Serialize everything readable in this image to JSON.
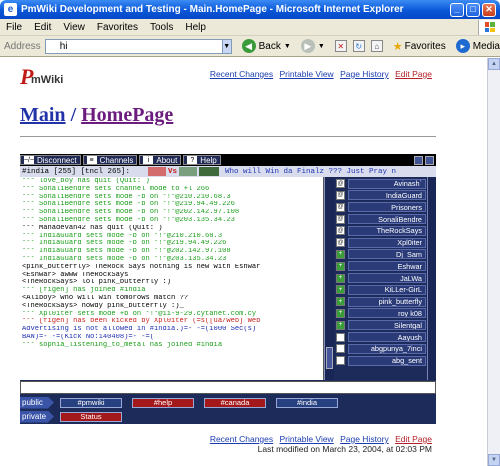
{
  "window": {
    "title": "PmWiki Development and Testing - Main.HomePage - Microsoft Internet Explorer",
    "min": "_",
    "max": "□",
    "close": "✕"
  },
  "menu": [
    "File",
    "Edit",
    "View",
    "Favorites",
    "Tools",
    "Help"
  ],
  "toolbar": {
    "address_label": "Address",
    "address_value": "hi",
    "back_label": "Back",
    "favorites_label": "Favorites",
    "media_label": "Media"
  },
  "page": {
    "logo_main": "P",
    "logo_sub": "mWiki",
    "links": [
      "Recent Changes",
      "Printable View",
      "Page History",
      "Edit Page"
    ],
    "group": "Main",
    "separator": "/",
    "pagename": "HomePage",
    "last_modified": "Last modified on March 23, 2004, at 02:03 PM"
  },
  "applet": {
    "buttons": {
      "disconnect": "Disconnect",
      "channels": "Channels",
      "about": "About",
      "help": "Help"
    },
    "topic": {
      "channel": "#india [255] [tncl 265]:",
      "vs": "Vs",
      "text": "Who will Win da Finalz ??? Just Pray n"
    },
    "log": [
      {
        "t": "*** love_boy has quit (Quit: )",
        "c": "green"
      },
      {
        "t": "*** SonaliBendre sets channel mode to +l 266",
        "c": "green"
      },
      {
        "t": "*** SonaliBendre sets mode -b on *!*@210.210.68.3",
        "c": "green"
      },
      {
        "t": "*** SonaliBendre sets mode -b on *!*@219.94.49.226",
        "c": "green"
      },
      {
        "t": "*** SonaliBendre sets mode -b on *!*@202.142.97.108",
        "c": "green"
      },
      {
        "t": "*** SonaliBendre sets mode -b on *!*@203.135.34.23",
        "c": "green"
      },
      {
        "t": "*** Mahadevan42 has quit (Quit: )",
        "c": "black"
      },
      {
        "t": "*** IndiaGuard sets mode -b on *!*@210.210.68.3",
        "c": "green"
      },
      {
        "t": "*** IndiaGuard sets mode -b on *!*@219.94.49.226",
        "c": "green"
      },
      {
        "t": "*** IndiaGuard sets mode -b on *!*@202.142.97.108",
        "c": "green"
      },
      {
        "t": "*** IndiaGuard sets mode -b on *!*@203.135.34.23",
        "c": "green"
      },
      {
        "t": "<pink_butterfly> TheRock Says nothing is new with Eshwar",
        "c": "black"
      },
      {
        "t": "<Eshwar> awww TheRockSays",
        "c": "black"
      },
      {
        "t": "<TheRockSays> lol pink_butterfly :)",
        "c": "black"
      },
      {
        "t": "*** [figen] has joined #india",
        "c": "green"
      },
      {
        "t": "<Aliboy> who will win tomorows match ??",
        "c": "black"
      },
      {
        "t": "<TheRockSays> howdy pink_butterfly :)_",
        "c": "black"
      },
      {
        "t": "*** Xpl0iter sets mode +b on *!*@1i-9-29.cytanet.com.cy",
        "c": "green"
      },
      {
        "t": "*** [figen] has been kicked by Xpl0iter (=s([ua/web] Web",
        "c": "red"
      },
      {
        "t": "    Advertising is not allowed in #india.)=- -=(1000 Sec(s)",
        "c": "blue"
      },
      {
        "t": "    BAN)=- -=(Kick No:140408)=- -=(",
        "c": "blue"
      },
      {
        "t": "*** sophia_listening_to_metal has joined #india",
        "c": "green"
      }
    ],
    "nicks": [
      {
        "name": "Avinash`",
        "icon": "@"
      },
      {
        "name": "IndiaGuard",
        "icon": "@"
      },
      {
        "name": "Prisoners",
        "icon": "@"
      },
      {
        "name": "SonaliBendre",
        "icon": "@"
      },
      {
        "name": "TheRockSays",
        "icon": "@"
      },
      {
        "name": "Xpl0iter",
        "icon": "@"
      },
      {
        "name": "Dj_Sam",
        "icon": "+"
      },
      {
        "name": "Eshwar",
        "icon": "+"
      },
      {
        "name": "JaLWa",
        "icon": "+"
      },
      {
        "name": "KiLLer-GirL",
        "icon": "+"
      },
      {
        "name": "pink_butterfly",
        "icon": "+"
      },
      {
        "name": "roy k08",
        "icon": "+"
      },
      {
        "name": "Silentgal",
        "icon": "+"
      },
      {
        "name": "Aayush",
        "icon": ""
      },
      {
        "name": "abgpunya_7inci",
        "icon": ""
      },
      {
        "name": "abg_sent",
        "icon": ""
      }
    ],
    "input_value": "",
    "rows": {
      "public_label": "public",
      "private_label": "private",
      "public_tabs": [
        {
          "label": "#pmwiki",
          "style": "blue"
        },
        {
          "label": "#help",
          "style": "red"
        },
        {
          "label": "#canada",
          "style": "red"
        },
        {
          "label": "#india",
          "style": "blue"
        }
      ],
      "private_tabs": [
        {
          "label": "Status",
          "style": "red"
        }
      ]
    }
  }
}
